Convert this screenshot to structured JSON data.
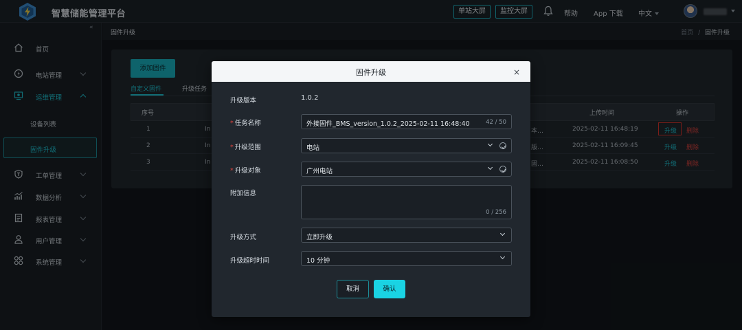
{
  "header": {
    "app_title": "智慧储能管理平台",
    "btn_station_screen": "单站大屏",
    "btn_monitor_screen": "监控大屏",
    "help": "帮助",
    "app_download": "App 下载",
    "language": "中文"
  },
  "sidebar": {
    "collapse_icon": "«",
    "items": [
      {
        "label": "首页",
        "icon": "home-icon"
      },
      {
        "label": "电站管理",
        "icon": "plant-icon"
      },
      {
        "label": "运维管理",
        "icon": "maintenance-icon"
      },
      {
        "label": "工单管理",
        "icon": "ticket-icon"
      },
      {
        "label": "数据分析",
        "icon": "chart-icon"
      },
      {
        "label": "报表管理",
        "icon": "report-icon"
      },
      {
        "label": "用户管理",
        "icon": "user-icon"
      },
      {
        "label": "系统管理",
        "icon": "system-icon"
      }
    ],
    "sub_items": [
      {
        "label": "设备列表"
      },
      {
        "label": "固件升级"
      }
    ]
  },
  "breadcrumb": {
    "page_title": "固件升级",
    "home": "首页",
    "separator": "/",
    "current": "固件升级"
  },
  "content": {
    "add_button": "添加固件",
    "tabs": [
      "自定义固件",
      "升级任务"
    ],
    "table": {
      "headers": {
        "index": "序号",
        "upload_time": "上传时间",
        "action": "操作"
      },
      "rows": [
        {
          "index": "1",
          "name_part": "In",
          "desc_part": "本…",
          "upload_time": "2025-02-11 16:48:19"
        },
        {
          "index": "2",
          "name_part": "In",
          "desc_part": "版…",
          "upload_time": "2025-02-11 16:09:45"
        },
        {
          "index": "3",
          "name_part": "In",
          "desc_part": "固…",
          "upload_time": "2025-02-11 16:08:50"
        }
      ],
      "action_upgrade": "升级",
      "action_delete": "删除"
    }
  },
  "modal": {
    "title": "固件升级",
    "close": "×",
    "version_label": "升级版本",
    "version_value": "1.0.2",
    "task_name_label": "任务名称",
    "task_name_value": "外接固件_BMS_version_1.0.2_2025-02-11 16:48:40",
    "task_name_count": "42 / 50",
    "scope_label": "升级范围",
    "scope_value": "电站",
    "target_label": "升级对象",
    "target_value": "广州电站",
    "extra_label": "附加信息",
    "extra_value": "",
    "extra_count": "0 / 256",
    "method_label": "升级方式",
    "method_value": "立即升级",
    "timeout_label": "升级超时时间",
    "timeout_value": "10 分钟",
    "required_mark": "*",
    "cancel": "取消",
    "confirm": "确认"
  },
  "colors": {
    "accent": "#1fc8d8",
    "danger": "#e0453f",
    "highlight_box": "#e0352f"
  }
}
